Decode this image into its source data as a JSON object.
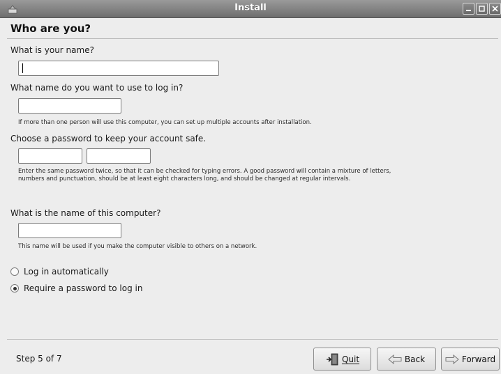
{
  "window": {
    "title": "Install"
  },
  "page": {
    "heading": "Who are you?"
  },
  "name": {
    "label": "What is your name?",
    "value": ""
  },
  "login": {
    "label": "What name do you want to use to log in?",
    "value": "",
    "hint": "If more than one person will use this computer, you can set up multiple accounts after installation."
  },
  "password": {
    "label": "Choose a password to keep your account safe.",
    "value": "",
    "confirm_value": "",
    "hint": "Enter the same password twice, so that it can be checked for typing errors. A good password will contain a mixture of letters, numbers and punctuation, should be at least eight characters long, and should be changed at regular intervals."
  },
  "computer": {
    "label": "What is the name of this computer?",
    "value": "",
    "hint": "This name will be used if you make the computer visible to others on a network."
  },
  "login_options": [
    {
      "label": "Log in automatically",
      "selected": false
    },
    {
      "label": "Require a password to log in",
      "selected": true
    }
  ],
  "footer": {
    "step": "Step 5 of 7",
    "quit_label": "Quit",
    "back_label": "Back",
    "forward_label": "Forward"
  },
  "icons": {
    "app": "installer-icon",
    "minimize": "minimize-icon",
    "maximize": "maximize-icon",
    "close": "close-icon",
    "quit": "quit-door-icon",
    "back": "arrow-left-icon",
    "forward": "arrow-right-icon"
  }
}
